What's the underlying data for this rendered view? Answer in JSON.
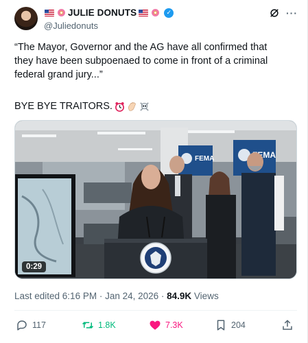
{
  "author": {
    "name": "JULIE DONUTS",
    "handle": "@Juliedonuts",
    "verified": true
  },
  "tweet": {
    "lines": [
      "“The Mayor, Governor and the AG have all confirmed that",
      "they have been subpoenaed to come in front of a criminal",
      "federal grand jury...”"
    ],
    "second_paragraph": "BYE BYE TRAITORS.",
    "emojis": [
      "alarm-clock",
      "waving-hand",
      "skull-and-crossbones"
    ]
  },
  "media": {
    "duration": "0:29",
    "signs": [
      "FEMA",
      "FEMA"
    ],
    "podium_seal_top": "U.S. DEPARTMENT OF",
    "podium_seal_bottom": "HOMELAND SECURITY"
  },
  "meta": {
    "edited": "Last edited 6:16 PM · Jan 24, 2026 · ",
    "views_count": "84.9K",
    "views_label": " Views"
  },
  "actions": {
    "replies": "117",
    "reposts": "1.8K",
    "likes": "7.3K",
    "bookmarks": "204"
  },
  "colors": {
    "accent": "#1d9bf0",
    "repost": "#00ba7c",
    "like": "#f91880",
    "secondary_text": "#536471"
  }
}
